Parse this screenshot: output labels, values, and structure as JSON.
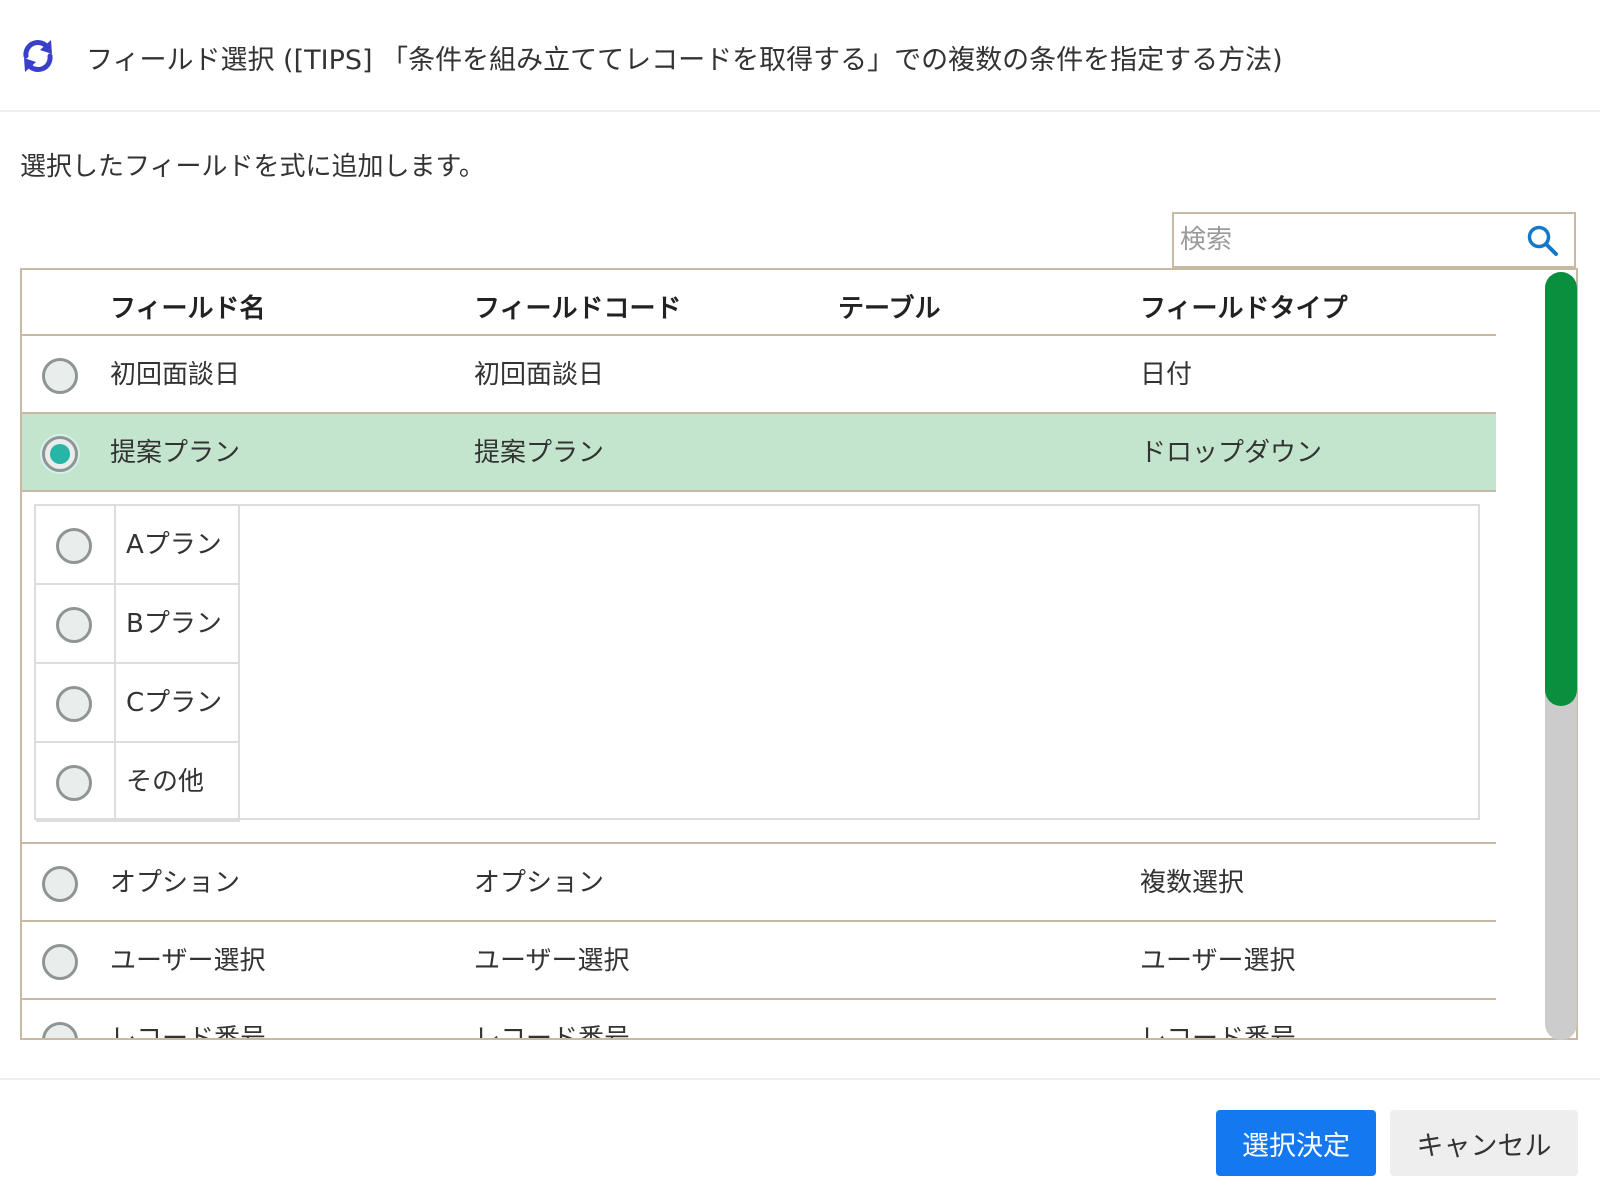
{
  "dialog": {
    "title": "フィールド選択 ([TIPS] 「条件を組み立ててレコードを取得する」での複数の条件を指定する方法)",
    "title_icon": "refresh-icon",
    "description": "選択したフィールドを式に追加します。"
  },
  "search": {
    "placeholder": "検索",
    "value": "",
    "icon": "search-icon"
  },
  "table": {
    "columns": [
      "フィールド名",
      "フィールドコード",
      "テーブル",
      "フィールドタイプ"
    ],
    "rows": [
      {
        "name": "初回面談日",
        "code": "初回面談日",
        "table": "",
        "type": "日付",
        "selected": false
      },
      {
        "name": "提案プラン",
        "code": "提案プラン",
        "table": "",
        "type": "ドロップダウン",
        "selected": true,
        "options": [
          "Aプラン",
          "Bプラン",
          "Cプラン",
          "その他"
        ]
      },
      {
        "name": "オプション",
        "code": "オプション",
        "table": "",
        "type": "複数選択",
        "selected": false
      },
      {
        "name": "ユーザー選択",
        "code": "ユーザー選択",
        "table": "",
        "type": "ユーザー選択",
        "selected": false
      },
      {
        "name": "レコード番号",
        "code": "レコード番号",
        "table": "",
        "type": "レコード番号",
        "selected": false
      }
    ]
  },
  "colors": {
    "selected_row": "#c4e5cd",
    "radio_checked": "#27b5a6",
    "scroll_thumb": "#0a8f3e",
    "primary_button": "#1478f0",
    "border": "#c8b9a4"
  },
  "footer": {
    "confirm_label": "選択決定",
    "cancel_label": "キャンセル"
  }
}
